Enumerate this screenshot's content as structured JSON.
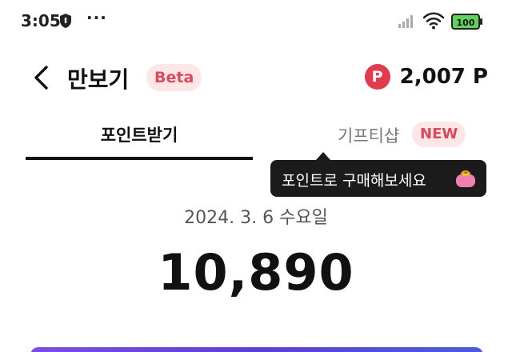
{
  "status_bar": {
    "time": "3:05",
    "dots": "···",
    "battery": "100"
  },
  "header": {
    "title": "만보기",
    "badge": "Beta",
    "points_icon": "P",
    "points": "2,007 P"
  },
  "tabs": [
    {
      "label": "포인트받기",
      "active": true
    },
    {
      "label": "기프티샵",
      "badge": "NEW",
      "active": false
    }
  ],
  "tooltip": {
    "text": "포인트로 구매해보세요",
    "icon": "purse-icon"
  },
  "main": {
    "date": "2024. 3. 6 수요일",
    "steps": "10,890"
  },
  "colors": {
    "accent": "#e23b4b",
    "badge_bg": "#fde6e8",
    "badge_text": "#d94a5a",
    "tooltip_bg": "#1b1b1b"
  }
}
